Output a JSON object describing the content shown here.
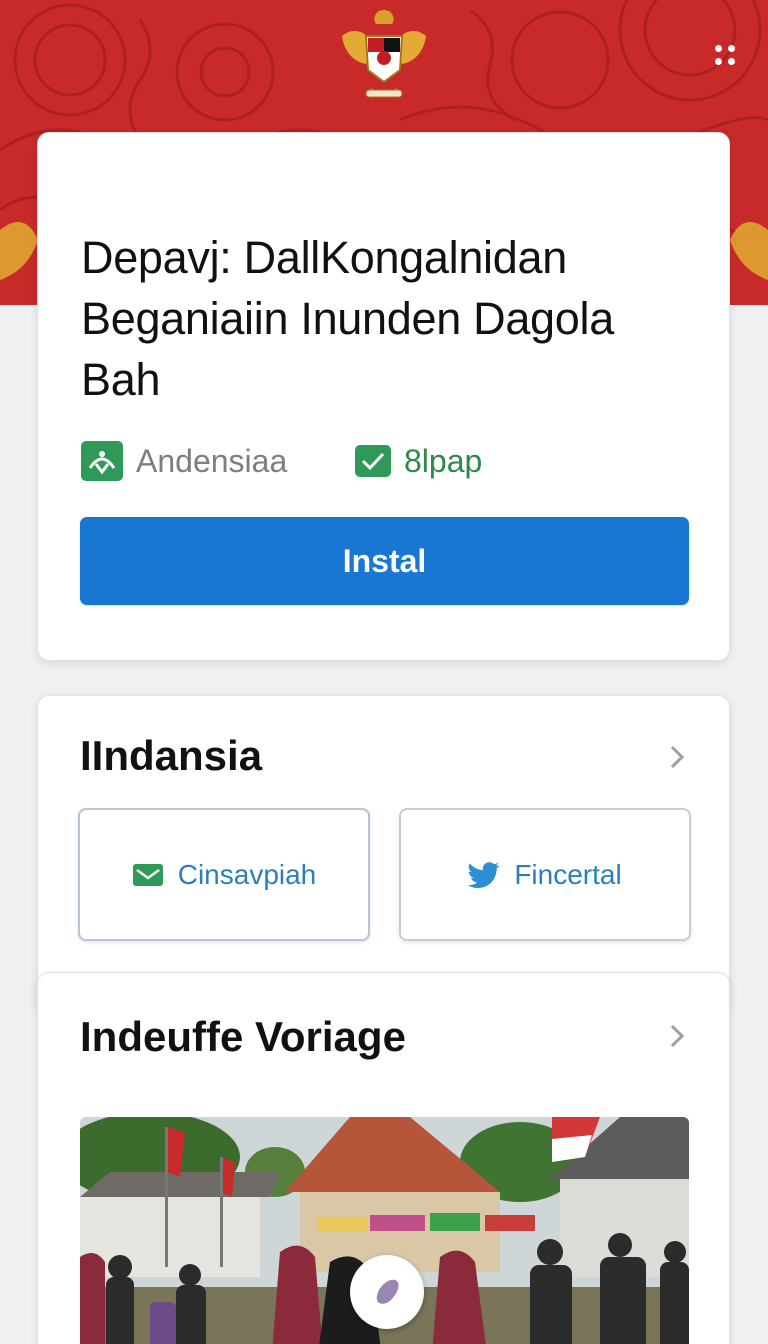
{
  "app": {
    "title": "Depavj: DallKongalnidan Beganiaiin Inunden Dagola Bah",
    "publisher": "Andensiaa",
    "size": "8lpap",
    "install_label": "Instal"
  },
  "header": {
    "emblem_icon": "garuda-emblem-icon",
    "menu_icon": "dots-grid-icon"
  },
  "social": {
    "title": "IIndansia",
    "buttons": [
      {
        "label": "Cinsavpiah",
        "icon": "mail-icon"
      },
      {
        "label": "Fincertal",
        "icon": "bird-icon"
      }
    ]
  },
  "village": {
    "title": "Indeuffe Voriage"
  },
  "colors": {
    "banner": "#c82a2a",
    "install": "#1877d2",
    "publisher_icon": "#2f9a57",
    "link": "#2a7fbd"
  }
}
